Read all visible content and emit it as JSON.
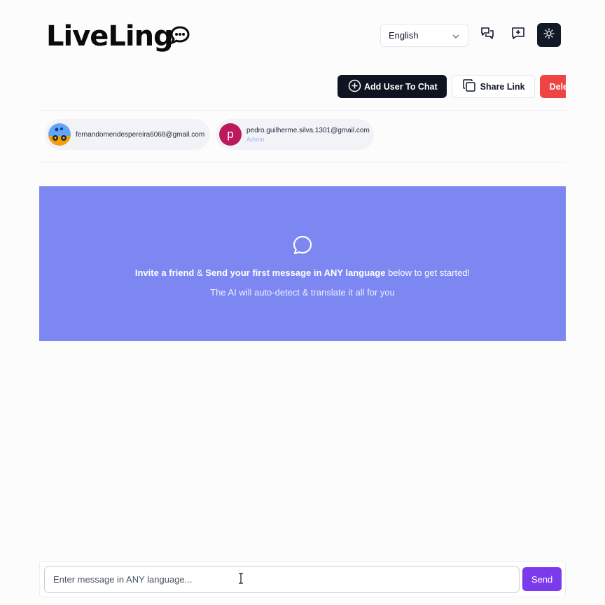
{
  "app": {
    "logo_text": "LiveLing",
    "accent_color": "#7c3aed",
    "banner_color": "#7c87f2",
    "delete_color": "#ef4444"
  },
  "header": {
    "language_select": {
      "selected": "English",
      "icon": "chevron-down-icon"
    },
    "icons": [
      "chats-icon",
      "new-chat-icon",
      "sun-icon"
    ]
  },
  "actions": {
    "add_user_label": "Add User To Chat",
    "share_link_label": "Share Link",
    "delete_label": "Delete"
  },
  "participants": [
    {
      "email": "fernandomendespereira6068@gmail.com",
      "role": "",
      "avatar": "photo"
    },
    {
      "email": "pedro.guilherme.silva.1301@gmail.com",
      "role": "Admin",
      "avatar_letter": "p"
    }
  ],
  "banner": {
    "invite_bold": "Invite a friend",
    "amp": " & ",
    "send_bold": "Send your first message in ANY language",
    "rest": " below to get started!",
    "subline": "The AI will auto-detect & translate it all for you"
  },
  "composer": {
    "placeholder": "Enter message in ANY language...",
    "value": "",
    "send_label": "Send"
  }
}
